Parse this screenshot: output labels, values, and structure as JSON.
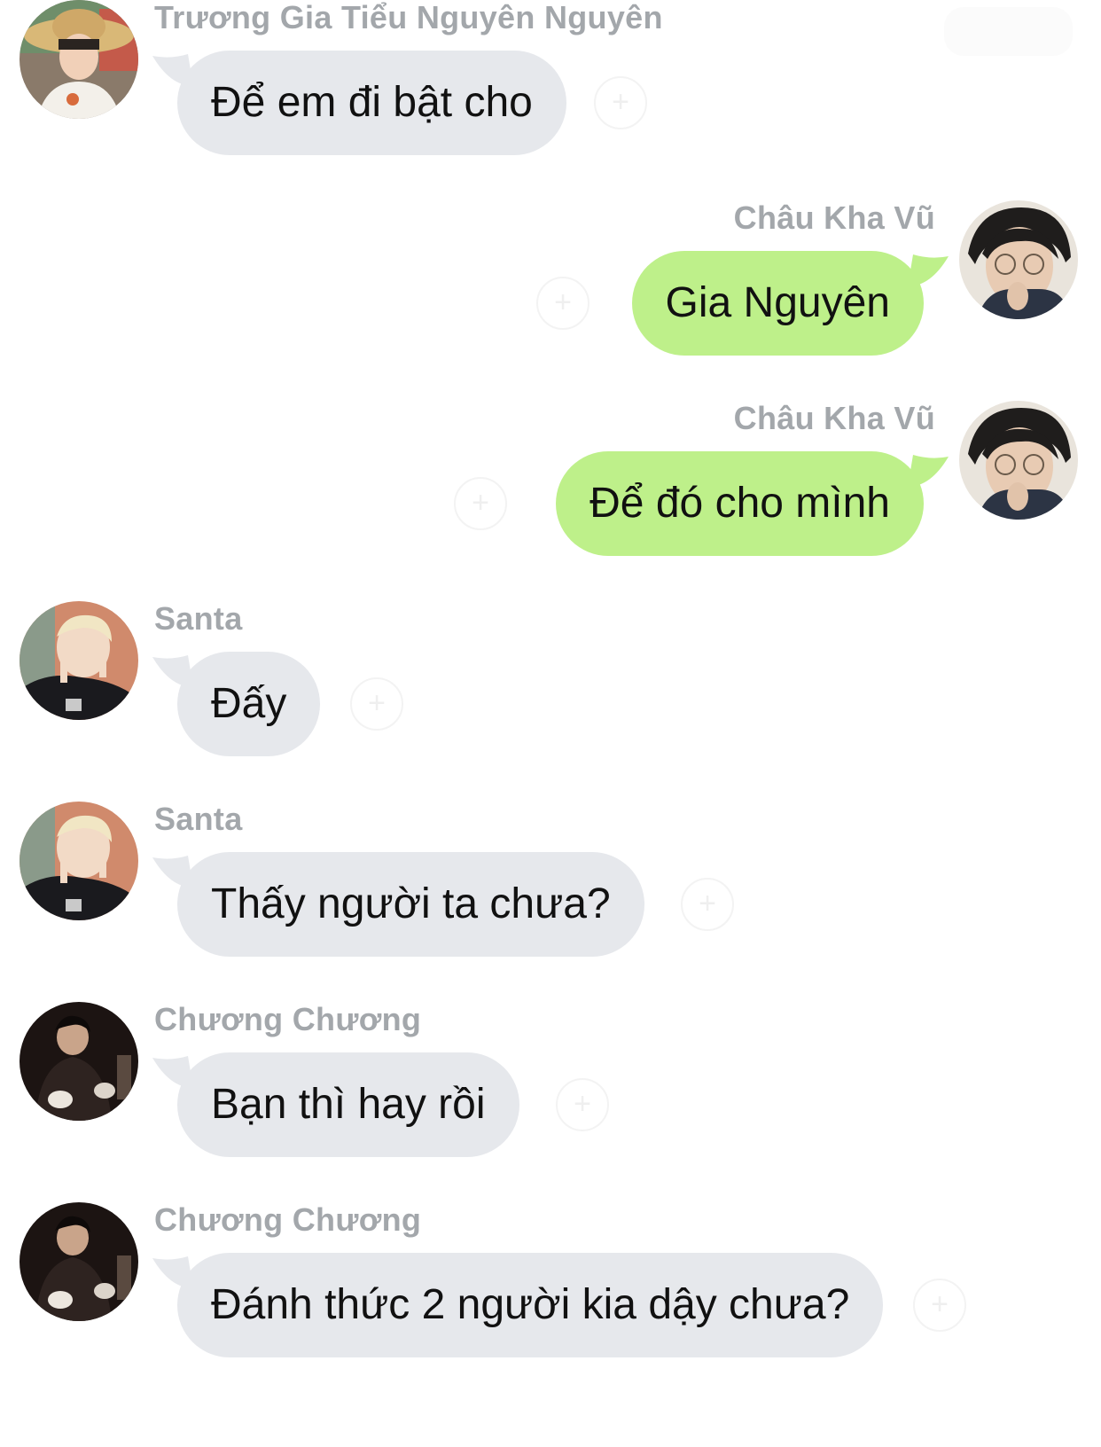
{
  "colors": {
    "incoming_bubble": "#e6e8ec",
    "outgoing_bubble": "#bef08a",
    "sender_name": "#a3a7ab",
    "text": "#111111",
    "background": "#ffffff"
  },
  "messages": [
    {
      "sender": "Trương Gia Tiểu Nguyên Nguyên",
      "text": "Để em đi bật cho",
      "side": "left",
      "avatar": "avatar-straw-hat"
    },
    {
      "sender": "Châu Kha Vũ",
      "text": "Gia Nguyên",
      "side": "right",
      "avatar": "avatar-glasses"
    },
    {
      "sender": "Châu Kha Vũ",
      "text": "Để đó cho mình",
      "side": "right",
      "avatar": "avatar-glasses"
    },
    {
      "sender": "Santa",
      "text": "Đấy",
      "side": "left",
      "avatar": "avatar-peace-sign"
    },
    {
      "sender": "Santa",
      "text": "Thấy người ta chưa?",
      "side": "left",
      "avatar": "avatar-peace-sign"
    },
    {
      "sender": "Chương Chương",
      "text": "Bạn thì hay rồi",
      "side": "left",
      "avatar": "avatar-dark-robe"
    },
    {
      "sender": "Chương Chương",
      "text": "Đánh thức 2 người kia dậy chưa?",
      "side": "left",
      "avatar": "avatar-dark-robe"
    }
  ],
  "reaction_icon": "add-reaction-icon"
}
